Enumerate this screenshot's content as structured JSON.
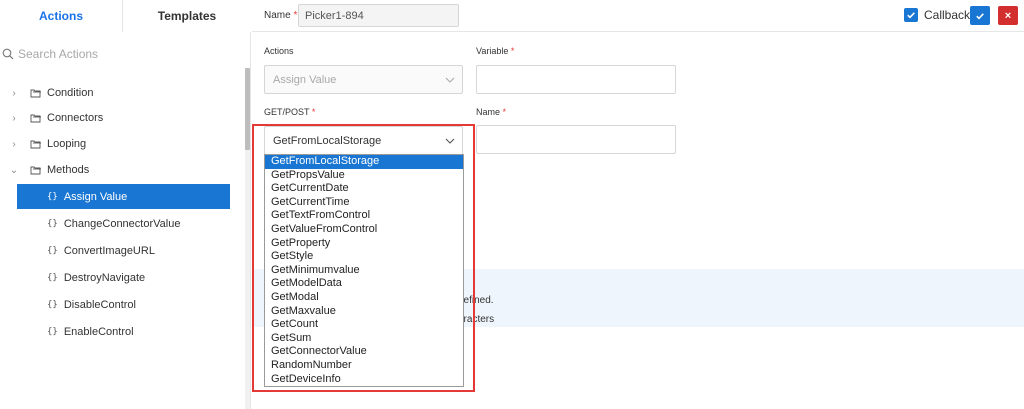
{
  "left_panel": {
    "tabs": [
      {
        "label": "Actions"
      },
      {
        "label": "Templates"
      }
    ],
    "search": {
      "placeholder": "Search Actions"
    },
    "tree": {
      "groups": [
        {
          "label": "Condition",
          "expanded": false
        },
        {
          "label": "Connectors",
          "expanded": false
        },
        {
          "label": "Looping",
          "expanded": false
        },
        {
          "label": "Methods",
          "expanded": true
        }
      ],
      "methods": [
        {
          "label": "Assign Value"
        },
        {
          "label": "ChangeConnectorValue"
        },
        {
          "label": "ConvertImageURL"
        },
        {
          "label": "DestroyNavigate"
        },
        {
          "label": "DisableControl"
        },
        {
          "label": "EnableControl"
        }
      ]
    }
  },
  "header": {
    "name_label": "Name",
    "required_mark": "*",
    "name_value": "Picker1-894",
    "callback_label": "Callback",
    "callback_checked": true,
    "ok_icon": "check-icon",
    "cancel_icon": "close-icon",
    "cancel_glyph": "×"
  },
  "form": {
    "actions_label": "Actions",
    "actions_value": "Assign Value",
    "variable_label": "Variable",
    "getpost_label": "GET/POST",
    "getpost_value": "GetFromLocalStorage",
    "name_label": "Name",
    "info_line1": "defined.",
    "info_line2": "aracters"
  },
  "dropdown": {
    "selected": "GetFromLocalStorage",
    "options": [
      "GetFromLocalStorage",
      "GetPropsValue",
      "GetCurrentDate",
      "GetCurrentTime",
      "GetTextFromControl",
      "GetValueFromControl",
      "GetProperty",
      "GetStyle",
      "GetMinimumvalue",
      "GetModelData",
      "GetModal",
      "GetMaxvalue",
      "GetCount",
      "GetSum",
      "GetConnectorValue",
      "RandomNumber",
      "GetDeviceInfo"
    ]
  },
  "colors": {
    "accent": "#1976d2",
    "danger": "#d32f2f",
    "highlight": "#e53935"
  }
}
